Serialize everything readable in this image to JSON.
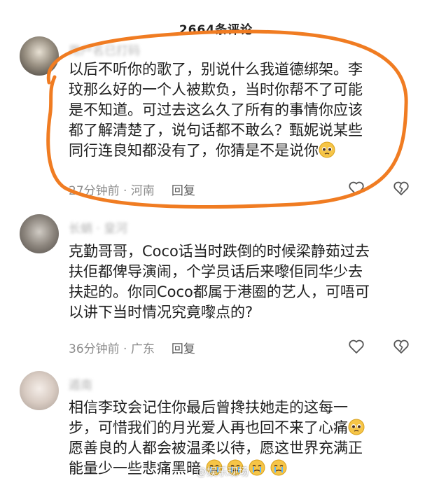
{
  "header": {
    "title": "2664条评论"
  },
  "comments": [
    {
      "username": "用户名已打码",
      "text_lines": [
        "以后不听你的歌了，别说什么我道德绑架。李",
        "玟那么好的一个人被欺负，当时你帮不了可能",
        "是不知道。可过去这么久了所有的事情你应该",
        "都了解清楚了，说句话都不敢么？甄妮说某些",
        "同行连良知都没有了，你猜是不是说你"
      ],
      "time": "27分钟前",
      "location": "河南",
      "reply_label": "回复"
    },
    {
      "username": "长蛸 · 皇河",
      "text_lines": [
        "克勤哥哥，Coco话当时跌倒的时候梁静茹过去",
        "扶佢都俾导演闹，个学员话后来嚟佢同华少去",
        "扶起的。你同Coco都属于港圈的艺人，可唔可",
        "以讲下当时情况究竟嚟点的?"
      ],
      "time": "36分钟前",
      "location": "广东",
      "reply_label": "回复"
    },
    {
      "username": "遁南",
      "text_lines": [
        "相信李玟会记住你最后曾搀扶她走的这每一",
        "步，可惜我们的月光爱人再也回不来了心痛",
        "愿善良的人都会被温柔以待，愿这世界充满正",
        "能量少一些悲痛黑暗"
      ]
    }
  ],
  "watermark": "@娱乐现场",
  "colors": {
    "highlight_stroke": "#f07c22",
    "meta_text": "#8c8c8c",
    "body_text": "#202020",
    "icon_stroke": "#555555",
    "emoji_fill": "#f6c547"
  },
  "icons": {
    "like": "heart-outline-icon",
    "dislike": "broken-heart-outline-icon",
    "emoji": "pleading-face-emoji-icon",
    "cry_emoji": "crying-face-emoji-icon"
  }
}
